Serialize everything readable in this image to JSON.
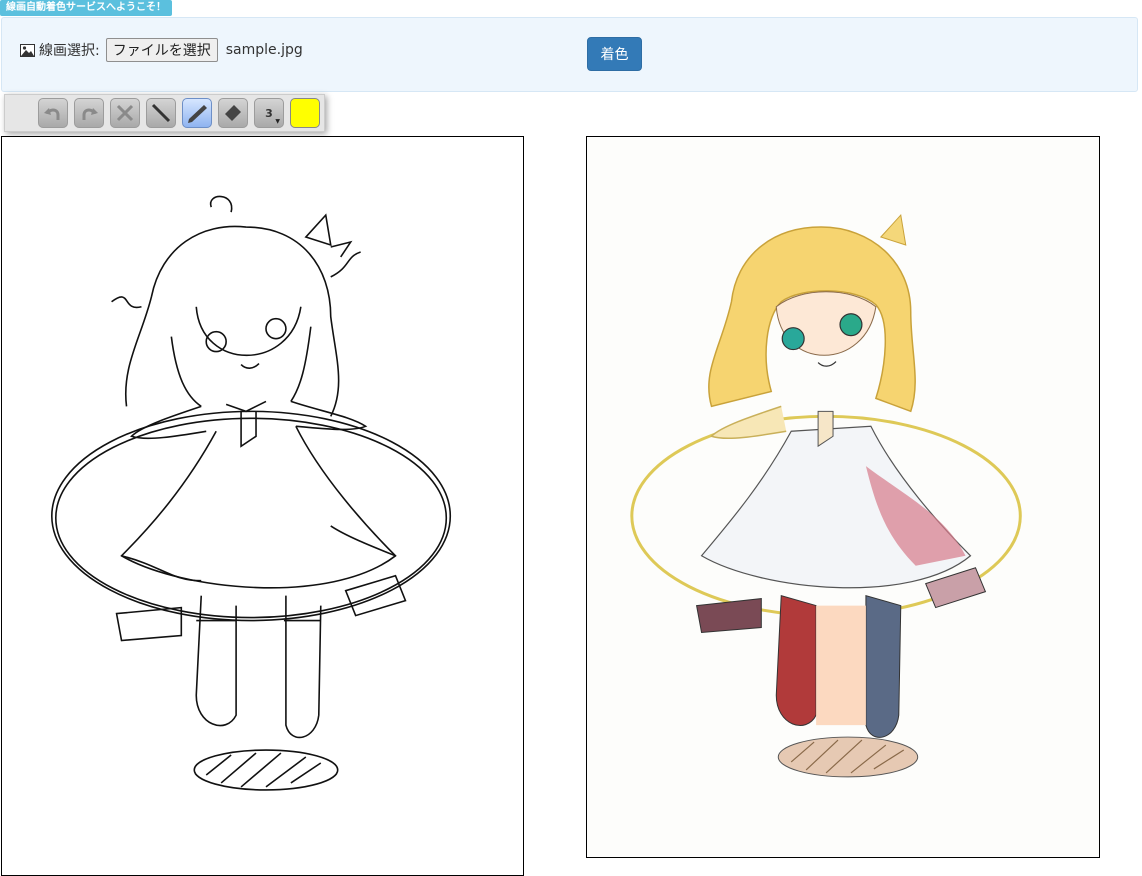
{
  "header": {
    "badge": "線画自動着色サービスへようこそ！"
  },
  "form": {
    "label": "線画選択:",
    "file_button": "ファイルを選択",
    "file_name": "sample.jpg",
    "color_button": "着色"
  },
  "toolbar": {
    "tools": [
      {
        "name": "undo-icon"
      },
      {
        "name": "redo-icon"
      },
      {
        "name": "clear-icon"
      },
      {
        "name": "line-icon"
      },
      {
        "name": "pen-icon",
        "active": true
      },
      {
        "name": "eraser-icon"
      },
      {
        "name": "brush-size",
        "value": "3"
      },
      {
        "name": "color-swatch",
        "color": "#ffff00"
      }
    ]
  },
  "colors": {
    "accent": "#337ab7",
    "badge": "#5bc0de",
    "panel": "#eef6fd",
    "swatch": "#ffff00"
  }
}
